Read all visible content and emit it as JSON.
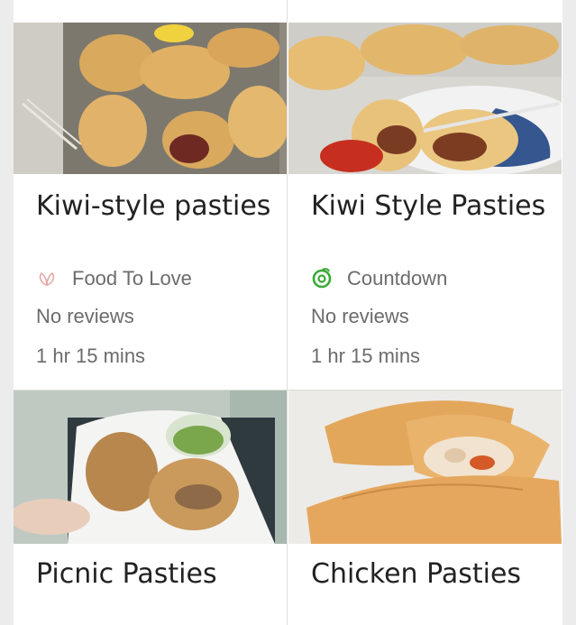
{
  "recipes": [
    {
      "title": "Kiwi-style pasties",
      "source": "Food To Love",
      "source_icon": "leaf-icon",
      "reviews": "No reviews",
      "time": "1 hr 15 mins"
    },
    {
      "title": "Kiwi Style Pasties",
      "source": "Countdown",
      "source_icon": "countdown-logo-icon",
      "reviews": "No reviews",
      "time": "1 hr 15 mins"
    },
    {
      "title": "Picnic Pasties"
    },
    {
      "title": "Chicken Pasties"
    }
  ],
  "colors": {
    "accent_pink": "#e9a7a7",
    "countdown_green": "#3aa935"
  }
}
